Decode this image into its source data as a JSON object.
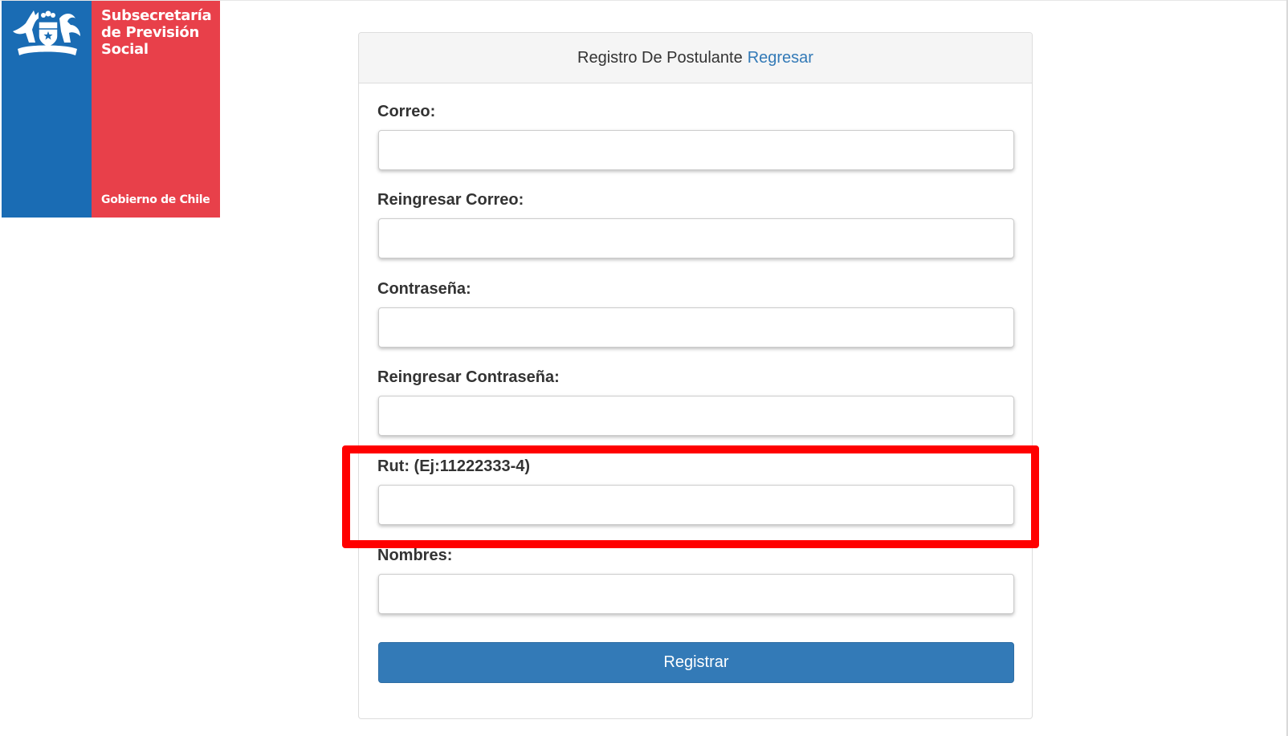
{
  "logo": {
    "title": "Subsecretaría\nde Previsión\nSocial",
    "footer": "Gobierno de Chile",
    "icon": "coat-of-arms-icon",
    "colors": {
      "blue": "#1a6cb4",
      "red": "#e8404a"
    }
  },
  "header": {
    "title": "Registro De Postulante",
    "back_link": "Regresar"
  },
  "form": {
    "fields": [
      {
        "label": "Correo:",
        "value": "",
        "placeholder": ""
      },
      {
        "label": "Reingresar Correo:",
        "value": "",
        "placeholder": ""
      },
      {
        "label": "Contraseña:",
        "value": "",
        "placeholder": ""
      },
      {
        "label": "Reingresar Contraseña:",
        "value": "",
        "placeholder": ""
      },
      {
        "label": "Rut: (Ej:11222333-4)",
        "value": "",
        "placeholder": ""
      },
      {
        "label": "Nombres:",
        "value": "",
        "placeholder": ""
      }
    ],
    "submit_label": "Registrar"
  },
  "colors": {
    "accent": "#337ab7",
    "highlight": "#ff0000"
  }
}
